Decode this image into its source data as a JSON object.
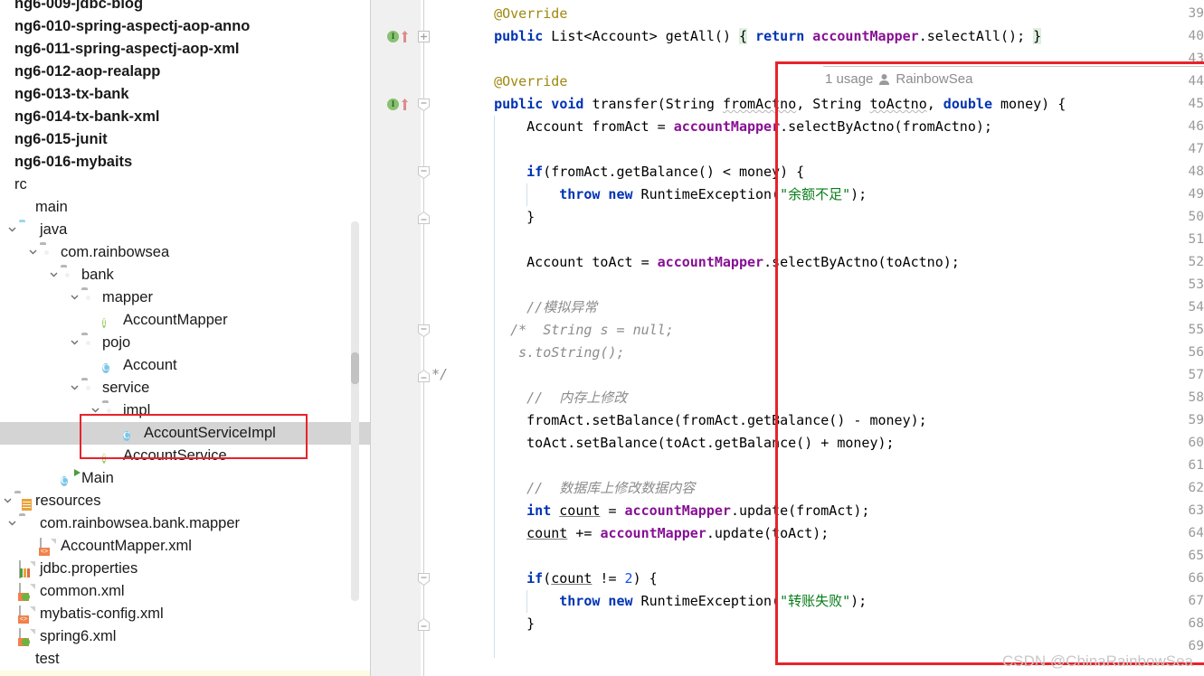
{
  "project_tree": {
    "name": "project-tool-window",
    "scrollbar": {
      "visible": true
    },
    "items": [
      {
        "label": "ng6-009-jdbc-blog",
        "indent": 0,
        "icon": "none",
        "twisty": "none",
        "bold": true,
        "selected": false,
        "clipped": true
      },
      {
        "label": "ng6-010-spring-aspectj-aop-anno",
        "indent": 0,
        "icon": "none",
        "twisty": "none",
        "bold": true,
        "selected": false,
        "clipped": true
      },
      {
        "label": "ng6-011-spring-aspectj-aop-xml",
        "indent": 0,
        "icon": "none",
        "twisty": "none",
        "bold": true,
        "selected": false,
        "clipped": true
      },
      {
        "label": "ng6-012-aop-realapp",
        "indent": 0,
        "icon": "none",
        "twisty": "none",
        "bold": true,
        "selected": false,
        "clipped": true
      },
      {
        "label": "ng6-013-tx-bank",
        "indent": 0,
        "icon": "none",
        "twisty": "none",
        "bold": true,
        "selected": false,
        "clipped": true
      },
      {
        "label": "ng6-014-tx-bank-xml",
        "indent": 0,
        "icon": "none",
        "twisty": "none",
        "bold": true,
        "selected": false,
        "clipped": true
      },
      {
        "label": "ng6-015-junit",
        "indent": 0,
        "icon": "none",
        "twisty": "none",
        "bold": true,
        "selected": false,
        "clipped": true
      },
      {
        "label": "ng6-016-mybaits",
        "indent": 0,
        "icon": "none",
        "twisty": "none",
        "bold": true,
        "selected": false,
        "clipped": true
      },
      {
        "label": "rc",
        "indent": 0,
        "icon": "none",
        "twisty": "none",
        "bold": false,
        "selected": false,
        "clipped": true
      },
      {
        "label": "main",
        "indent": 0,
        "icon": "block-icon",
        "twisty": "none",
        "bold": false,
        "selected": false,
        "clipped": false
      },
      {
        "label": "java",
        "indent": 1,
        "icon": "folder-blue-icon",
        "twisty": "expanded",
        "bold": false,
        "selected": false,
        "clipped": false
      },
      {
        "label": "com.rainbowsea",
        "indent": 2,
        "icon": "folder-package-icon",
        "twisty": "expanded",
        "bold": false,
        "selected": false,
        "clipped": false
      },
      {
        "label": "bank",
        "indent": 3,
        "icon": "folder-package-icon",
        "twisty": "expanded",
        "bold": false,
        "selected": false,
        "clipped": false
      },
      {
        "label": "mapper",
        "indent": 4,
        "icon": "folder-package-icon",
        "twisty": "expanded",
        "bold": false,
        "selected": false,
        "clipped": false
      },
      {
        "label": "AccountMapper",
        "indent": 5,
        "icon": "interface-icon",
        "twisty": "none",
        "bold": false,
        "selected": false,
        "clipped": false
      },
      {
        "label": "pojo",
        "indent": 4,
        "icon": "folder-package-icon",
        "twisty": "expanded",
        "bold": false,
        "selected": false,
        "clipped": false
      },
      {
        "label": "Account",
        "indent": 5,
        "icon": "class-icon",
        "twisty": "none",
        "bold": false,
        "selected": false,
        "clipped": false
      },
      {
        "label": "service",
        "indent": 4,
        "icon": "folder-package-icon",
        "twisty": "expanded",
        "bold": false,
        "selected": false,
        "clipped": false
      },
      {
        "label": "impl",
        "indent": 5,
        "icon": "folder-package-icon",
        "twisty": "expanded",
        "bold": false,
        "selected": false,
        "clipped": false
      },
      {
        "label": "AccountServiceImpl",
        "indent": 6,
        "icon": "class-icon",
        "twisty": "none",
        "bold": false,
        "selected": true,
        "clipped": false
      },
      {
        "label": "AccountService",
        "indent": 5,
        "icon": "interface-icon",
        "twisty": "none",
        "bold": false,
        "selected": false,
        "clipped": false
      },
      {
        "label": "Main",
        "indent": 3,
        "icon": "class-runnable-icon",
        "twisty": "none",
        "bold": false,
        "selected": false,
        "clipped": false
      },
      {
        "label": "resources",
        "indent": 0,
        "icon": "resources-folder-icon",
        "twisty": "expanded",
        "bold": false,
        "selected": false,
        "clipped": true
      },
      {
        "label": "com.rainbowsea.bank.mapper",
        "indent": 1,
        "icon": "folder-plain-icon",
        "twisty": "expanded",
        "bold": false,
        "selected": false,
        "clipped": false
      },
      {
        "label": "AccountMapper.xml",
        "indent": 2,
        "icon": "xml-file-icon",
        "twisty": "none",
        "bold": false,
        "selected": false,
        "clipped": false
      },
      {
        "label": "jdbc.properties",
        "indent": 1,
        "icon": "properties-file-icon",
        "twisty": "none",
        "bold": false,
        "selected": false,
        "clipped": false
      },
      {
        "label": "common.xml",
        "indent": 1,
        "icon": "spring-xml-file-icon",
        "twisty": "none",
        "bold": false,
        "selected": false,
        "clipped": false
      },
      {
        "label": "mybatis-config.xml",
        "indent": 1,
        "icon": "xml-file-icon",
        "twisty": "none",
        "bold": false,
        "selected": false,
        "clipped": false
      },
      {
        "label": "spring6.xml",
        "indent": 1,
        "icon": "spring-xml-file-icon",
        "twisty": "none",
        "bold": false,
        "selected": false,
        "clipped": false
      },
      {
        "label": "test",
        "indent": 0,
        "icon": "block-icon",
        "twisty": "none",
        "bold": false,
        "selected": false,
        "clipped": true
      }
    ]
  },
  "editor": {
    "inlay_hint": {
      "usages": "1 usage",
      "author": "RainbowSea"
    },
    "gutter_run_markers": [
      {
        "line": 40,
        "glyph": "I",
        "overridden": true
      },
      {
        "line": 45,
        "glyph": "I",
        "overridden": true
      }
    ],
    "fold_markers": [
      {
        "line": 40,
        "state": "collapsed"
      },
      {
        "line": 45,
        "state": "expanded-start"
      },
      {
        "line": 48,
        "state": "expanded-start"
      },
      {
        "line": 50,
        "state": "expanded-end"
      },
      {
        "line": 55,
        "state": "expanded-start"
      },
      {
        "line": 57,
        "state": "expanded-end",
        "suffix": "*/"
      },
      {
        "line": 66,
        "state": "expanded-start"
      },
      {
        "line": 68,
        "state": "expanded-end"
      }
    ],
    "lines": [
      {
        "no": 39,
        "indent": 4,
        "tokens": [
          {
            "t": "@Override",
            "c": "an"
          }
        ]
      },
      {
        "no": 40,
        "indent": 4,
        "tokens": [
          {
            "t": "public",
            "c": "k"
          },
          {
            "t": " ",
            "c": "pl"
          },
          {
            "t": "List<Account>",
            "c": "pl"
          },
          {
            "t": " getAll() ",
            "c": "pl"
          },
          {
            "t": "{",
            "c": "br"
          },
          {
            "t": " ",
            "c": "pl"
          },
          {
            "t": "return",
            "c": "k"
          },
          {
            "t": " ",
            "c": "pl"
          },
          {
            "t": "accountMapper",
            "c": "fld"
          },
          {
            "t": ".selectAll();",
            "c": "pl"
          },
          {
            "t": " ",
            "c": "pl"
          },
          {
            "t": "}",
            "c": "br"
          }
        ]
      },
      {
        "no": 43,
        "indent": 4,
        "tokens": []
      },
      {
        "no": 44,
        "indent": 4,
        "tokens": [
          {
            "t": "@Override",
            "c": "an"
          }
        ]
      },
      {
        "no": 45,
        "indent": 4,
        "tokens": [
          {
            "t": "public",
            "c": "k"
          },
          {
            "t": " ",
            "c": "pl"
          },
          {
            "t": "void",
            "c": "k"
          },
          {
            "t": " transfer(String ",
            "c": "pl"
          },
          {
            "t": "fromActno",
            "c": "wav"
          },
          {
            "t": ", String ",
            "c": "pl"
          },
          {
            "t": "toActno",
            "c": "wav"
          },
          {
            "t": ", ",
            "c": "pl"
          },
          {
            "t": "double",
            "c": "k"
          },
          {
            "t": " money) ",
            "c": "pl"
          },
          {
            "t": "{",
            "c": "pl"
          }
        ]
      },
      {
        "no": 46,
        "indent": 8,
        "tokens": [
          {
            "t": "Account fromAct = ",
            "c": "pl"
          },
          {
            "t": "accountMapper",
            "c": "fld"
          },
          {
            "t": ".selectByActno(fromActno);",
            "c": "pl"
          }
        ]
      },
      {
        "no": 47,
        "indent": 8,
        "tokens": []
      },
      {
        "no": 48,
        "indent": 8,
        "tokens": [
          {
            "t": "if",
            "c": "k"
          },
          {
            "t": "(fromAct.getBalance() < money) {",
            "c": "pl"
          }
        ]
      },
      {
        "no": 49,
        "indent": 12,
        "tokens": [
          {
            "t": "throw",
            "c": "k"
          },
          {
            "t": " ",
            "c": "pl"
          },
          {
            "t": "new",
            "c": "k"
          },
          {
            "t": " RuntimeException(",
            "c": "pl"
          },
          {
            "t": "\"余额不足\"",
            "c": "st"
          },
          {
            "t": ");",
            "c": "pl"
          }
        ]
      },
      {
        "no": 50,
        "indent": 8,
        "tokens": [
          {
            "t": "}",
            "c": "pl"
          }
        ]
      },
      {
        "no": 51,
        "indent": 8,
        "tokens": []
      },
      {
        "no": 52,
        "indent": 8,
        "tokens": [
          {
            "t": "Account toAct = ",
            "c": "pl"
          },
          {
            "t": "accountMapper",
            "c": "fld"
          },
          {
            "t": ".selectByActno(toActno);",
            "c": "pl"
          }
        ]
      },
      {
        "no": 53,
        "indent": 8,
        "tokens": []
      },
      {
        "no": 54,
        "indent": 8,
        "tokens": [
          {
            "t": "//模拟异常",
            "c": "cm"
          }
        ]
      },
      {
        "no": 55,
        "indent": 6,
        "tokens": [
          {
            "t": "/*  String s = null;",
            "c": "cm"
          }
        ]
      },
      {
        "no": 56,
        "indent": 7,
        "tokens": [
          {
            "t": "s.toString();",
            "c": "cm"
          }
        ]
      },
      {
        "no": 57,
        "indent": 8,
        "tokens": []
      },
      {
        "no": 58,
        "indent": 8,
        "tokens": [
          {
            "t": "//  内存上修改",
            "c": "cm"
          }
        ]
      },
      {
        "no": 59,
        "indent": 8,
        "tokens": [
          {
            "t": "fromAct.setBalance(fromAct.getBalance() - money);",
            "c": "pl"
          }
        ]
      },
      {
        "no": 60,
        "indent": 8,
        "tokens": [
          {
            "t": "toAct.setBalance(toAct.getBalance() + money);",
            "c": "pl"
          }
        ]
      },
      {
        "no": 61,
        "indent": 8,
        "tokens": []
      },
      {
        "no": 62,
        "indent": 8,
        "tokens": [
          {
            "t": "//  数据库上修改数据内容",
            "c": "cm"
          }
        ]
      },
      {
        "no": 63,
        "indent": 8,
        "tokens": [
          {
            "t": "int",
            "c": "k"
          },
          {
            "t": " ",
            "c": "pl"
          },
          {
            "t": "count",
            "c": "und"
          },
          {
            "t": " = ",
            "c": "pl"
          },
          {
            "t": "accountMapper",
            "c": "fld"
          },
          {
            "t": ".update(fromAct);",
            "c": "pl"
          }
        ]
      },
      {
        "no": 64,
        "indent": 8,
        "tokens": [
          {
            "t": "count",
            "c": "und"
          },
          {
            "t": " += ",
            "c": "pl"
          },
          {
            "t": "accountMapper",
            "c": "fld"
          },
          {
            "t": ".update(toAct);",
            "c": "pl"
          }
        ]
      },
      {
        "no": 65,
        "indent": 8,
        "tokens": []
      },
      {
        "no": 66,
        "indent": 8,
        "tokens": [
          {
            "t": "if",
            "c": "k"
          },
          {
            "t": "(",
            "c": "pl"
          },
          {
            "t": "count",
            "c": "und"
          },
          {
            "t": " != ",
            "c": "pl"
          },
          {
            "t": "2",
            "c": "num"
          },
          {
            "t": ") {",
            "c": "pl"
          }
        ]
      },
      {
        "no": 67,
        "indent": 12,
        "tokens": [
          {
            "t": "throw",
            "c": "k"
          },
          {
            "t": " ",
            "c": "pl"
          },
          {
            "t": "new",
            "c": "k"
          },
          {
            "t": " RuntimeException(",
            "c": "pl"
          },
          {
            "t": "\"转账失败\"",
            "c": "st"
          },
          {
            "t": ");",
            "c": "pl"
          }
        ]
      },
      {
        "no": 68,
        "indent": 8,
        "tokens": [
          {
            "t": "}",
            "c": "pl"
          }
        ]
      },
      {
        "no": 69,
        "indent": 8,
        "tokens": []
      }
    ]
  },
  "annotations": {
    "editor_highlight_box": {
      "color": "#e8232a"
    },
    "sidebar_highlight_box": {
      "color": "#e8232a"
    }
  },
  "watermark": {
    "text": "CSDN @ChinaRainbowSea"
  }
}
